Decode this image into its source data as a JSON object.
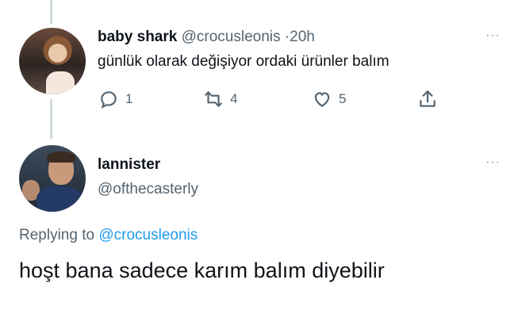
{
  "tweet1": {
    "display_name": "baby shark",
    "handle": "@crocusleonis",
    "separator": "·",
    "time": "20h",
    "text": "günlük olarak değişiyor ordaki ürünler balım",
    "reply_count": "1",
    "retweet_count": "4",
    "like_count": "5",
    "more": "···"
  },
  "tweet2": {
    "display_name": "lannister",
    "handle": "@ofthecasterly",
    "more": "···",
    "replying_prefix": "Replying to",
    "replying_handle": "@crocusleonis",
    "text": "hoşt bana sadece karım balım diyebilir"
  },
  "colors": {
    "text": "#0f1419",
    "secondary": "#536471",
    "link": "#1d9bf0",
    "thread_line": "#cfd9de"
  },
  "icons": [
    "reply-icon",
    "retweet-icon",
    "like-icon",
    "share-icon",
    "more-icon"
  ]
}
